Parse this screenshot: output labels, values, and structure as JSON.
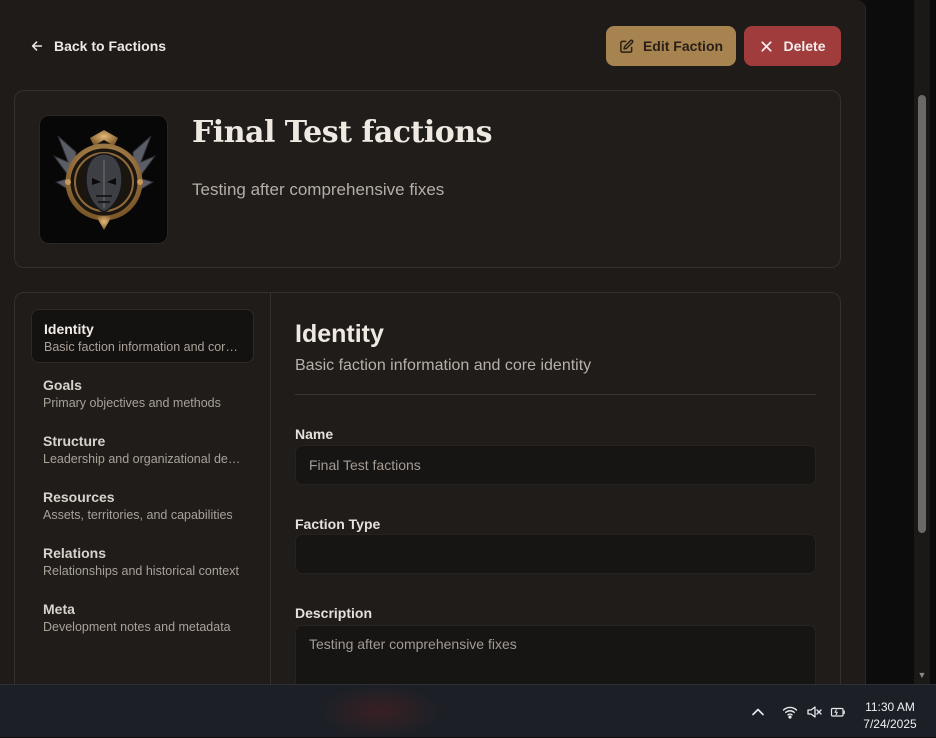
{
  "header": {
    "back_label": "Back to Factions",
    "edit_label": "Edit Faction",
    "delete_label": "Delete"
  },
  "faction": {
    "title": "Final Test factions",
    "subtitle": "Testing after comprehensive fixes"
  },
  "nav": {
    "items": [
      {
        "title": "Identity",
        "desc": "Basic faction information and core identity",
        "active": true
      },
      {
        "title": "Goals",
        "desc": "Primary objectives and methods"
      },
      {
        "title": "Structure",
        "desc": "Leadership and organizational details"
      },
      {
        "title": "Resources",
        "desc": "Assets, territories, and capabilities"
      },
      {
        "title": "Relations",
        "desc": "Relationships and historical context"
      },
      {
        "title": "Meta",
        "desc": "Development notes and metadata"
      }
    ]
  },
  "section": {
    "title": "Identity",
    "subtitle": "Basic faction information and core identity"
  },
  "form": {
    "name_label": "Name",
    "name_value": "Final Test factions",
    "type_label": "Faction Type",
    "type_value": "",
    "description_label": "Description",
    "description_value": "Testing after comprehensive fixes"
  },
  "taskbar": {
    "time": "11:30 AM",
    "date": "7/24/2025",
    "icons": [
      "chevron-up-icon",
      "wifi-icon",
      "volume-muted-icon",
      "battery-icon"
    ]
  },
  "colors": {
    "accent_gold": "#a7834f",
    "danger_red": "#a13c3c",
    "background": "#1e1b19"
  }
}
